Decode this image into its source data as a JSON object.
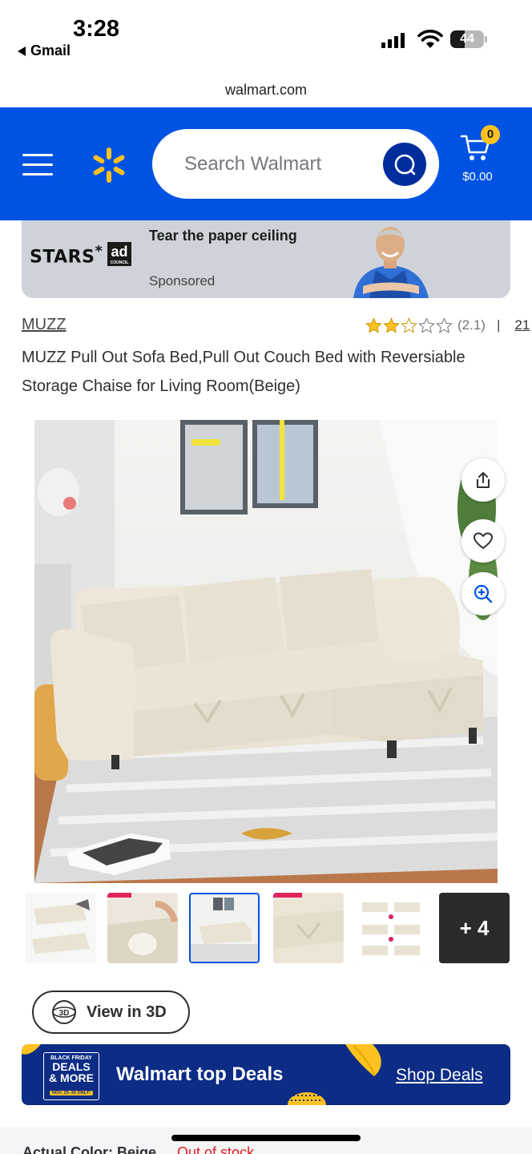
{
  "status_bar": {
    "time": "3:28",
    "back_app": "Gmail",
    "battery_level": "44",
    "battery_fraction": 0.44
  },
  "browser": {
    "url": "walmart.com"
  },
  "header": {
    "search_placeholder": "Search Walmart",
    "cart_count": "0",
    "cart_total": "$0.00",
    "brand_color": "#0053e2",
    "spark_color": "#ffc220"
  },
  "ad": {
    "logo_text": "STARS",
    "council_text": "ad",
    "council_small": "COUNCIL",
    "headline": "Tear the paper ceiling",
    "sponsored_label": "Sponsored"
  },
  "product": {
    "brand": "MUZZ",
    "rating_stars": 2.1,
    "rating_value": "(2.1)",
    "separator": "|",
    "review_count": "21",
    "title": "MUZZ Pull Out Sofa Bed,Pull Out Couch Bed with Reversiable Storage Chaise for Living Room(Beige)"
  },
  "image_actions": {
    "share_icon": "share-icon",
    "favorite_icon": "heart-icon",
    "zoom_icon": "zoom-in-icon"
  },
  "thumbnails": {
    "selected_index": 2,
    "more_label": "+ 4"
  },
  "view_3d": {
    "label": "View in 3D",
    "icon_text": "3D"
  },
  "deals_banner": {
    "badge_top": "BLACK FRIDAY",
    "badge_line1": "DEALS",
    "badge_line2": "& MORE",
    "badge_date": "NOV. 25–30 ONLY!",
    "title": "Walmart top Deals",
    "link": "Shop Deals"
  },
  "footer_peek": {
    "label": "Actual Color: Beige",
    "status": "Out of stock"
  }
}
